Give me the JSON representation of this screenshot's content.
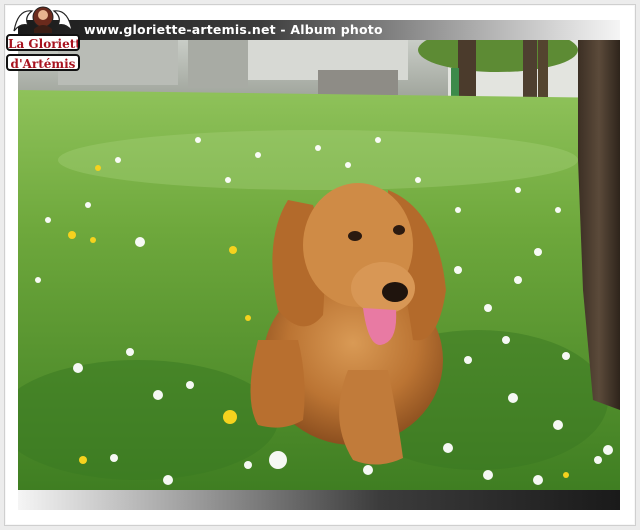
{
  "header": {
    "title": "www.gloriette-artemis.net - Album photo"
  },
  "logo": {
    "line1": "La Gloriette",
    "line2": "d'Artémis"
  },
  "photo": {
    "subject": "dog-photo"
  },
  "colors": {
    "brand_red": "#a8131f",
    "bar_dark": "#1a1a1a",
    "bar_light": "#f5f5f5"
  }
}
